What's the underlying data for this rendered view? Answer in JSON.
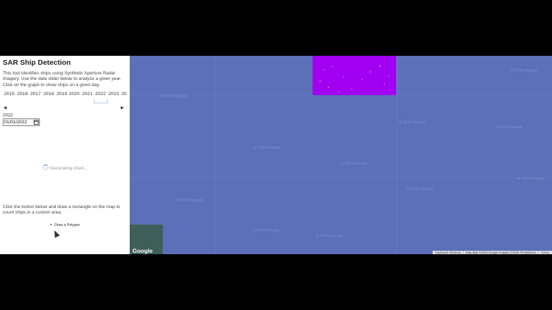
{
  "sidebar": {
    "title": "SAR Ship Detection",
    "description": "This tool identifies ships using Synthetic Aperture Radar imagery. Use the date slider below to analyze a given year. Click on the graph to show ships on a given day.",
    "years": [
      "2015",
      "2016",
      "2017",
      "2018",
      "2019",
      "2020",
      "2021",
      "2022",
      "2023",
      "20"
    ],
    "selected_year": "2022",
    "prev_arrow": "◀",
    "next_arrow": "▶",
    "year_display": "2022",
    "date_value": "01/01/2022",
    "loading_text": "Generating chart...",
    "instructions": "Click the button below and draw a rectangle on the map to count ships in a custom area.",
    "draw_button_label": "Draw a Polygon"
  },
  "map": {
    "watermark": "© 2024 Google",
    "logo": "Google",
    "attribution": {
      "shortcuts": "Keyboard shortcuts",
      "map_data": "Map data ©2024 Google Imagery ©2024 TerraMetrics",
      "terms": "Terms"
    },
    "colors": {
      "water": "#5c6fb9",
      "ship_layer": "#a200f2",
      "land": "#3e5f59"
    }
  }
}
